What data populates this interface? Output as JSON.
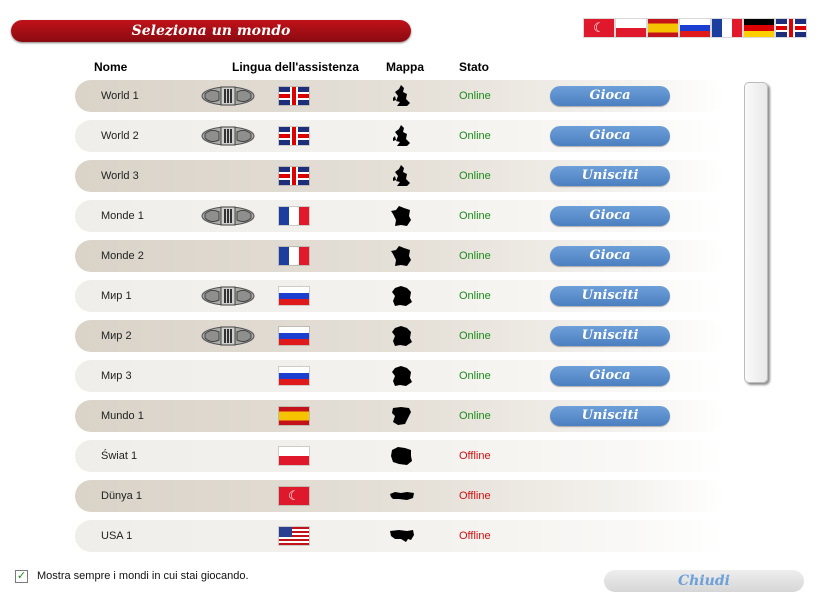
{
  "title": "Seleziona un mondo",
  "top_flags": [
    {
      "country": "tr"
    },
    {
      "country": "pl"
    },
    {
      "country": "es"
    },
    {
      "country": "ru"
    },
    {
      "country": "fr"
    },
    {
      "country": "de"
    },
    {
      "country": "gb"
    }
  ],
  "headers": {
    "name": "Nome",
    "language": "Lingua dell'assistenza",
    "map": "Mappa",
    "status": "Stato"
  },
  "worlds": [
    {
      "name": "World 1",
      "emblem": true,
      "flag": "gb",
      "map": "uk-map-icon",
      "status": "Online",
      "online": true,
      "action": "Gioca"
    },
    {
      "name": "World 2",
      "emblem": true,
      "flag": "gb",
      "map": "uk-map-icon",
      "status": "Online",
      "online": true,
      "action": "Gioca"
    },
    {
      "name": "World 3",
      "emblem": false,
      "flag": "gb",
      "map": "uk-map-icon",
      "status": "Online",
      "online": true,
      "action": "Unisciti"
    },
    {
      "name": "Monde 1",
      "emblem": true,
      "flag": "fr",
      "map": "france-map-icon",
      "status": "Online",
      "online": true,
      "action": "Gioca"
    },
    {
      "name": "Monde 2",
      "emblem": false,
      "flag": "fr",
      "map": "france-map-icon",
      "status": "Online",
      "online": true,
      "action": "Gioca"
    },
    {
      "name": "Мир 1",
      "emblem": true,
      "flag": "ru",
      "map": "russia-map-icon",
      "status": "Online",
      "online": true,
      "action": "Unisciti"
    },
    {
      "name": "Мир 2",
      "emblem": true,
      "flag": "ru",
      "map": "russia-map-icon",
      "status": "Online",
      "online": true,
      "action": "Unisciti"
    },
    {
      "name": "Мир 3",
      "emblem": false,
      "flag": "ru",
      "map": "russia-map-icon",
      "status": "Online",
      "online": true,
      "action": "Gioca"
    },
    {
      "name": "Mundo 1",
      "emblem": false,
      "flag": "es",
      "map": "spain-map-icon",
      "status": "Online",
      "online": true,
      "action": "Unisciti"
    },
    {
      "name": "Świat 1",
      "emblem": false,
      "flag": "pl",
      "map": "poland-map-icon",
      "status": "Offline",
      "online": false,
      "action": ""
    },
    {
      "name": "Dünya 1",
      "emblem": false,
      "flag": "tr",
      "map": "turkey-map-icon",
      "status": "Offline",
      "online": false,
      "action": ""
    },
    {
      "name": "USA 1",
      "emblem": false,
      "flag": "us",
      "map": "usa-map-icon",
      "status": "Offline",
      "online": false,
      "action": ""
    }
  ],
  "footer": {
    "checkbox_label": "Mostra sempre i mondi in cui stai giocando.",
    "checkbox_checked": true,
    "close_label": "Chiudi"
  },
  "colors": {
    "title_red": "#b0101a",
    "button_blue": "#5a8ccc",
    "online": "#1a8a1a",
    "offline": "#d01010"
  }
}
